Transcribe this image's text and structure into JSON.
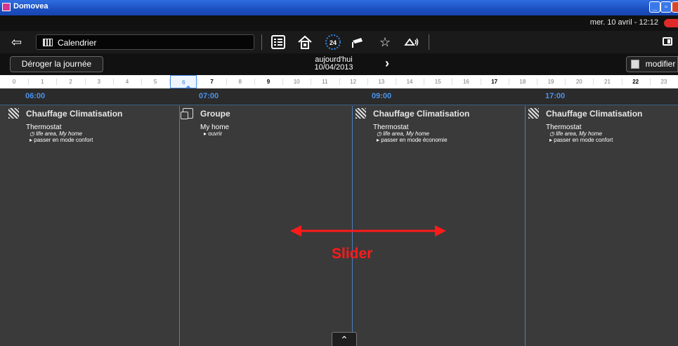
{
  "window": {
    "title": "Domovea"
  },
  "status": {
    "datetime": "mer. 10 avril - 12:12"
  },
  "toolbar": {
    "section_label": "Calendrier",
    "icons": [
      "back-arrow-icon",
      "calendar-icon",
      "list-icon",
      "home-icon",
      "24h-icon",
      "camera-icon",
      "star-icon",
      "alert-icon",
      "panel-icon"
    ]
  },
  "daybar": {
    "derog_label": "Déroger la journée",
    "today_label": "aujourd'hui",
    "today_date": "10/04/2013",
    "next_label": "›",
    "modifier_label": "modifier"
  },
  "ruler": {
    "hours": [
      "0",
      "1",
      "2",
      "3",
      "4",
      "5",
      "6",
      "7",
      "8",
      "9",
      "10",
      "11",
      "12",
      "13",
      "14",
      "15",
      "16",
      "17",
      "18",
      "19",
      "20",
      "21",
      "22",
      "23"
    ],
    "bold_hours": [
      "7",
      "9",
      "17",
      "22"
    ],
    "active_hour": "6"
  },
  "events": [
    {
      "time": "06:00",
      "title": "Chauffage Climatisation",
      "icon": "heating-icon",
      "device": "Thermostat",
      "location": "life area, My home",
      "action": "passer en mode confort"
    },
    {
      "time": "07:00",
      "title": "Groupe",
      "icon": "group-icon",
      "device": "My home",
      "location": "",
      "action": "ouvrir"
    },
    {
      "time": "09:00",
      "title": "Chauffage Climatisation",
      "icon": "heating-icon",
      "device": "Thermostat",
      "location": "life area, My home",
      "action": "passer en mode économie"
    },
    {
      "time": "17:00",
      "title": "Chauffage Climatisation",
      "icon": "heating-icon",
      "device": "Thermostat",
      "location": "life area, My home",
      "action": "passer en mode confort"
    }
  ],
  "annotation": {
    "label": "Slider",
    "color": "#ff1a1a"
  },
  "colors": {
    "accent": "#4a94ee",
    "background": "#3a3a3a",
    "toolbar": "#1a1a1a"
  }
}
